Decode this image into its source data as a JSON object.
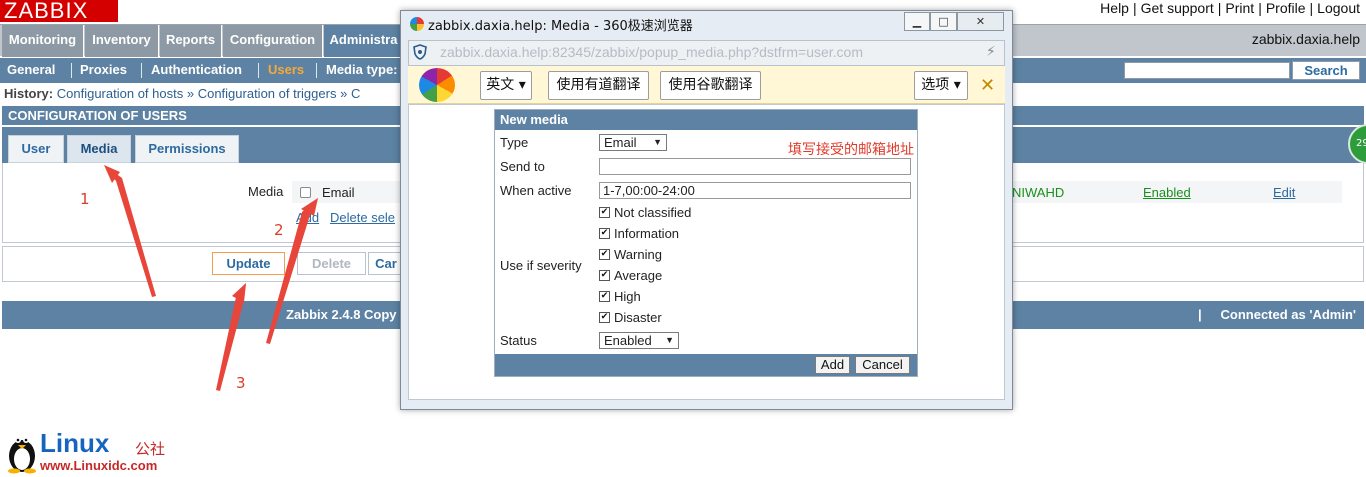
{
  "zabbix": {
    "logo": "ZABBIX",
    "top_links": [
      "Help",
      "Get support",
      "Print",
      "Profile",
      "Logout"
    ],
    "hostname": "zabbix.daxia.help",
    "main_menu": [
      "Monitoring",
      "Inventory",
      "Reports",
      "Configuration",
      "Administra"
    ],
    "sub_menu": [
      "General",
      "Proxies",
      "Authentication",
      "Users",
      "Media type:"
    ],
    "search_button": "Search",
    "history_label": "History:",
    "history_items": [
      "Configuration of hosts",
      "»",
      "Configuration of triggers",
      "»",
      "C"
    ],
    "section_title": "CONFIGURATION OF USERS",
    "tabs": [
      "User",
      "Media",
      "Permissions"
    ],
    "media_label": "Media",
    "media_row": {
      "type": "Email",
      "severity": "NIWAHD",
      "status": "Enabled",
      "edit": "Edit"
    },
    "add_link": "Add",
    "delete_link": "Delete sele",
    "buttons": {
      "update": "Update",
      "delete": "Delete",
      "cancel": "Car"
    },
    "footer_version": "Zabbix 2.4.8 Copy",
    "footer_pipe": "|",
    "footer_connected": "Connected as 'Admin'",
    "badge": "29"
  },
  "annotations": {
    "n1": "1",
    "n2": "2",
    "n3": "3",
    "note": "填写接受的邮箱地址"
  },
  "popup": {
    "title": "zabbix.daxia.help: Media - 360极速浏览器",
    "address": "zabbix.daxia.help:82345/zabbix/popup_media.php?dstfrm=user.com",
    "translate_bar": {
      "lang": "英文",
      "youdao": "使用有道翻译",
      "google": "使用谷歌翻译",
      "options": "选项",
      "close": "✕"
    },
    "form": {
      "title": "New media",
      "type_label": "Type",
      "type_value": "Email",
      "sendto_label": "Send to",
      "sendto_value": "",
      "when_label": "When active",
      "when_value": "1-7,00:00-24:00",
      "severity_label": "Use if severity",
      "severities": [
        "Not classified",
        "Information",
        "Warning",
        "Average",
        "High",
        "Disaster"
      ],
      "status_label": "Status",
      "status_value": "Enabled",
      "add_button": "Add",
      "cancel_button": "Cancel"
    }
  },
  "watermark": {
    "brand": "Linux",
    "cn": "公社",
    "url": "www.Linuxidc.com"
  }
}
